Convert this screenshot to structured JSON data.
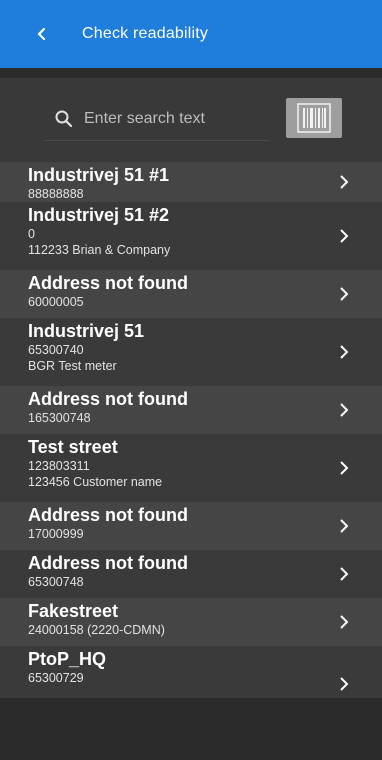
{
  "header": {
    "title": "Check readability",
    "back_icon": "chevron-left-icon"
  },
  "search": {
    "placeholder": "Enter search text",
    "value": "",
    "icon": "search-icon",
    "scan_icon": "barcode-icon"
  },
  "items": [
    {
      "title": "Industrivej 51 #1",
      "lines": [
        "88888888"
      ]
    },
    {
      "title": "Industrivej 51 #2",
      "lines": [
        "0",
        "112233 Brian & Company"
      ]
    },
    {
      "title": "Address not found",
      "lines": [
        "60000005"
      ]
    },
    {
      "title": "Industrivej 51",
      "lines": [
        "65300740",
        "BGR Test meter"
      ]
    },
    {
      "title": "Address not found",
      "lines": [
        "165300748"
      ]
    },
    {
      "title": "Test street",
      "lines": [
        "123803311",
        "123456 Customer name"
      ]
    },
    {
      "title": "Address not found",
      "lines": [
        "17000999"
      ]
    },
    {
      "title": "Address not found",
      "lines": [
        "65300748"
      ]
    },
    {
      "title": "Fakestreet",
      "lines": [
        "24000158 (2220-CDMN)"
      ]
    },
    {
      "title": "PtoP_HQ",
      "lines": [
        "65300729"
      ]
    }
  ],
  "colors": {
    "appbar": "#1f7ddb",
    "background": "#2b2b2b",
    "row_a": "#454545",
    "row_b": "#3a3a3a"
  }
}
